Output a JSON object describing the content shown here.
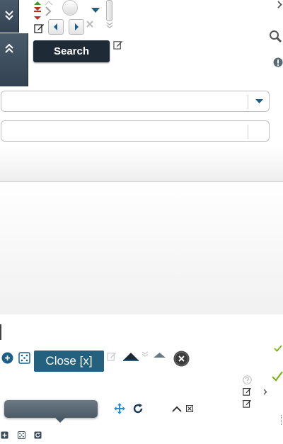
{
  "toolbar": {
    "search_label": "Search"
  },
  "dialog": {
    "close_label": "Close [x]"
  },
  "icons": {
    "expand": "double-chevron-down-icon",
    "collapse": "double-chevron-up-icon",
    "search": "magnifier-icon",
    "alert": "exclamation-icon",
    "edit": "pencil-edit-icon",
    "help": "question-icon",
    "check": "checkmark-icon",
    "move": "move-arrows-icon",
    "refresh": "refresh-icon",
    "close": "x-circle-icon"
  },
  "colors": {
    "dark_button": "#1e2b37",
    "close_button": "#24617e",
    "side_tab": "#3b4b5a",
    "accent_blue": "#1a5e8a",
    "check_green": "#7ab317"
  }
}
